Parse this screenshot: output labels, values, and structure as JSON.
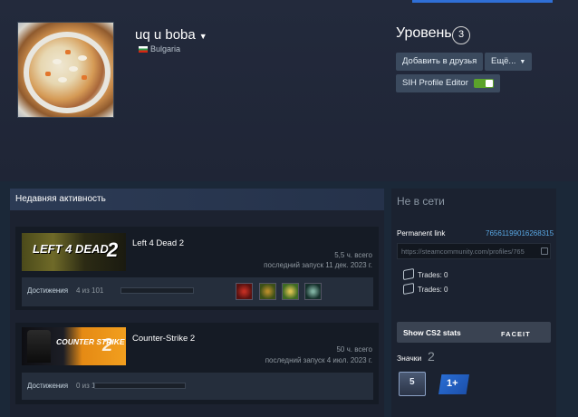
{
  "profile": {
    "name": "uq u boba",
    "country": "Bulgaria",
    "level_label": "Уровень",
    "level": "3"
  },
  "actions": {
    "add_friend": "Добавить в друзья",
    "more": "Ещё...",
    "sih_editor": "SIH Profile Editor"
  },
  "activity": {
    "title": "Недавняя активность",
    "games": [
      {
        "name": "Left 4 Dead 2",
        "capsule_text": "LEFT 4 DEAD",
        "capsule_num": "2",
        "hours": "5,5 ч. всего",
        "last_played": "последний запуск 11 дек. 2023 г.",
        "ach_label": "Достижения",
        "ach_count": "4 из 101"
      },
      {
        "name": "Counter-Strike 2",
        "capsule_text": "COUNTER STRIKE",
        "capsule_num": "2",
        "hours": "50 ч. всего",
        "last_played": "последний запуск 4 июл. 2023 г.",
        "ach_label": "Достижения",
        "ach_count": "0 из 1"
      }
    ]
  },
  "sidebar": {
    "status": "Не в сети",
    "permanent_link_label": "Permanent link",
    "steam_id": "76561199016268315",
    "profile_url": "https://steamcommunity.com/profiles/765",
    "trades_1": "Trades: 0",
    "trades_2": "Trades: 0",
    "cs2_stats": "Show CS2 stats",
    "faceit": "FACEIT",
    "badges_label": "Значки",
    "badges_count": "2",
    "badge_1": "5",
    "badge_2": "1+"
  },
  "colors": {
    "background": "#1b2838",
    "accent_link": "#5aa9e6",
    "toggle_on": "#5ba32b"
  }
}
